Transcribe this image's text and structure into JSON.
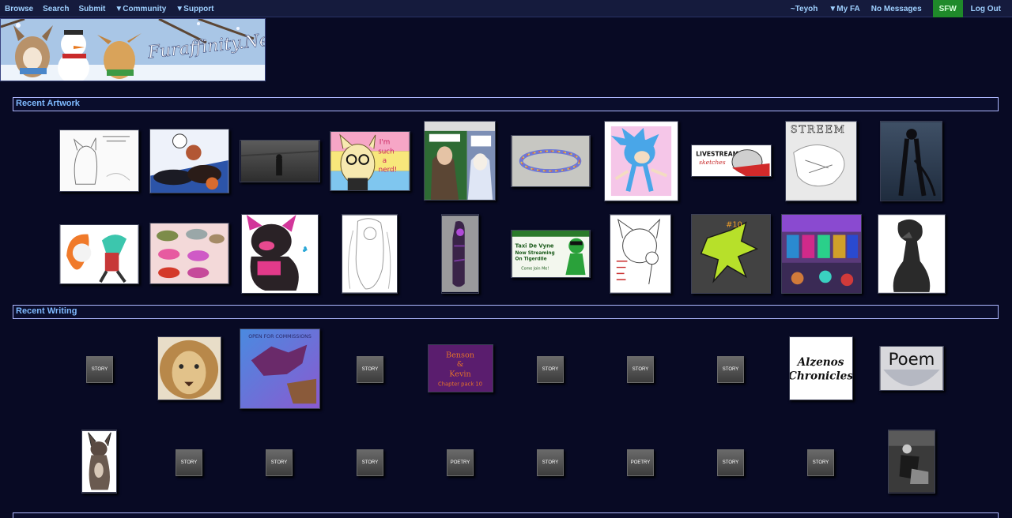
{
  "nav": {
    "left": [
      "Browse",
      "Search",
      "Submit",
      "▼Community",
      "▼Support"
    ],
    "user": "~Teyoh",
    "myfa": "▼My FA",
    "messages": "No Messages",
    "sfw": "SFW",
    "logout": "Log Out"
  },
  "banner": {
    "logo_text": "Furaffinity.Net"
  },
  "sections": {
    "artwork": "Recent Artwork",
    "writing": "Recent Writing"
  },
  "thumb_text": {
    "livestream": "LIVESTREAM",
    "sketches": "sketches",
    "stream": "STREEM",
    "nerd_1": "I'm",
    "nerd_2": "such",
    "nerd_3": "a",
    "nerd_4": "nerd!",
    "taxi_1": "Taxi De Vyne",
    "taxi_2": "Now Streaming",
    "taxi_3": "On Tigerdile",
    "taxi_4": "Come Join Me!",
    "open_comm": "OPEN FOR COMMISSIONS",
    "benson_1": "Benson",
    "benson_2": "&",
    "benson_3": "Kevin",
    "benson_4": "Chapter pack 10",
    "alzenos_1": "Alzenos",
    "alzenos_2": "Chronicles",
    "poem": "Poem"
  },
  "writing_icons": {
    "story": "STORY",
    "poetry": "POETRY"
  },
  "colors": {
    "background": "#080a24",
    "nav_bg": "#151b3d",
    "link": "#9fd0ff",
    "sfw_green": "#1f8a2a",
    "section_border": "#aeb8ff"
  }
}
